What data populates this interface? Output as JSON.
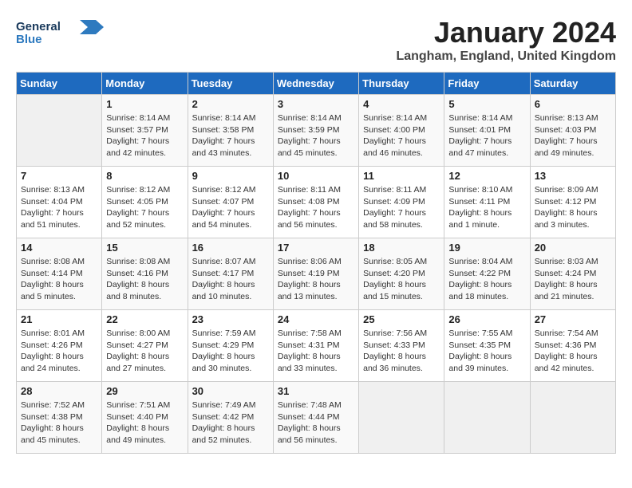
{
  "header": {
    "logo_general": "General",
    "logo_blue": "Blue",
    "title": "January 2024",
    "subtitle": "Langham, England, United Kingdom"
  },
  "columns": [
    "Sunday",
    "Monday",
    "Tuesday",
    "Wednesday",
    "Thursday",
    "Friday",
    "Saturday"
  ],
  "weeks": [
    [
      {
        "day": "",
        "info": ""
      },
      {
        "day": "1",
        "info": "Sunrise: 8:14 AM\nSunset: 3:57 PM\nDaylight: 7 hours\nand 42 minutes."
      },
      {
        "day": "2",
        "info": "Sunrise: 8:14 AM\nSunset: 3:58 PM\nDaylight: 7 hours\nand 43 minutes."
      },
      {
        "day": "3",
        "info": "Sunrise: 8:14 AM\nSunset: 3:59 PM\nDaylight: 7 hours\nand 45 minutes."
      },
      {
        "day": "4",
        "info": "Sunrise: 8:14 AM\nSunset: 4:00 PM\nDaylight: 7 hours\nand 46 minutes."
      },
      {
        "day": "5",
        "info": "Sunrise: 8:14 AM\nSunset: 4:01 PM\nDaylight: 7 hours\nand 47 minutes."
      },
      {
        "day": "6",
        "info": "Sunrise: 8:13 AM\nSunset: 4:03 PM\nDaylight: 7 hours\nand 49 minutes."
      }
    ],
    [
      {
        "day": "7",
        "info": "Sunrise: 8:13 AM\nSunset: 4:04 PM\nDaylight: 7 hours\nand 51 minutes."
      },
      {
        "day": "8",
        "info": "Sunrise: 8:12 AM\nSunset: 4:05 PM\nDaylight: 7 hours\nand 52 minutes."
      },
      {
        "day": "9",
        "info": "Sunrise: 8:12 AM\nSunset: 4:07 PM\nDaylight: 7 hours\nand 54 minutes."
      },
      {
        "day": "10",
        "info": "Sunrise: 8:11 AM\nSunset: 4:08 PM\nDaylight: 7 hours\nand 56 minutes."
      },
      {
        "day": "11",
        "info": "Sunrise: 8:11 AM\nSunset: 4:09 PM\nDaylight: 7 hours\nand 58 minutes."
      },
      {
        "day": "12",
        "info": "Sunrise: 8:10 AM\nSunset: 4:11 PM\nDaylight: 8 hours\nand 1 minute."
      },
      {
        "day": "13",
        "info": "Sunrise: 8:09 AM\nSunset: 4:12 PM\nDaylight: 8 hours\nand 3 minutes."
      }
    ],
    [
      {
        "day": "14",
        "info": "Sunrise: 8:08 AM\nSunset: 4:14 PM\nDaylight: 8 hours\nand 5 minutes."
      },
      {
        "day": "15",
        "info": "Sunrise: 8:08 AM\nSunset: 4:16 PM\nDaylight: 8 hours\nand 8 minutes."
      },
      {
        "day": "16",
        "info": "Sunrise: 8:07 AM\nSunset: 4:17 PM\nDaylight: 8 hours\nand 10 minutes."
      },
      {
        "day": "17",
        "info": "Sunrise: 8:06 AM\nSunset: 4:19 PM\nDaylight: 8 hours\nand 13 minutes."
      },
      {
        "day": "18",
        "info": "Sunrise: 8:05 AM\nSunset: 4:20 PM\nDaylight: 8 hours\nand 15 minutes."
      },
      {
        "day": "19",
        "info": "Sunrise: 8:04 AM\nSunset: 4:22 PM\nDaylight: 8 hours\nand 18 minutes."
      },
      {
        "day": "20",
        "info": "Sunrise: 8:03 AM\nSunset: 4:24 PM\nDaylight: 8 hours\nand 21 minutes."
      }
    ],
    [
      {
        "day": "21",
        "info": "Sunrise: 8:01 AM\nSunset: 4:26 PM\nDaylight: 8 hours\nand 24 minutes."
      },
      {
        "day": "22",
        "info": "Sunrise: 8:00 AM\nSunset: 4:27 PM\nDaylight: 8 hours\nand 27 minutes."
      },
      {
        "day": "23",
        "info": "Sunrise: 7:59 AM\nSunset: 4:29 PM\nDaylight: 8 hours\nand 30 minutes."
      },
      {
        "day": "24",
        "info": "Sunrise: 7:58 AM\nSunset: 4:31 PM\nDaylight: 8 hours\nand 33 minutes."
      },
      {
        "day": "25",
        "info": "Sunrise: 7:56 AM\nSunset: 4:33 PM\nDaylight: 8 hours\nand 36 minutes."
      },
      {
        "day": "26",
        "info": "Sunrise: 7:55 AM\nSunset: 4:35 PM\nDaylight: 8 hours\nand 39 minutes."
      },
      {
        "day": "27",
        "info": "Sunrise: 7:54 AM\nSunset: 4:36 PM\nDaylight: 8 hours\nand 42 minutes."
      }
    ],
    [
      {
        "day": "28",
        "info": "Sunrise: 7:52 AM\nSunset: 4:38 PM\nDaylight: 8 hours\nand 45 minutes."
      },
      {
        "day": "29",
        "info": "Sunrise: 7:51 AM\nSunset: 4:40 PM\nDaylight: 8 hours\nand 49 minutes."
      },
      {
        "day": "30",
        "info": "Sunrise: 7:49 AM\nSunset: 4:42 PM\nDaylight: 8 hours\nand 52 minutes."
      },
      {
        "day": "31",
        "info": "Sunrise: 7:48 AM\nSunset: 4:44 PM\nDaylight: 8 hours\nand 56 minutes."
      },
      {
        "day": "",
        "info": ""
      },
      {
        "day": "",
        "info": ""
      },
      {
        "day": "",
        "info": ""
      }
    ]
  ]
}
